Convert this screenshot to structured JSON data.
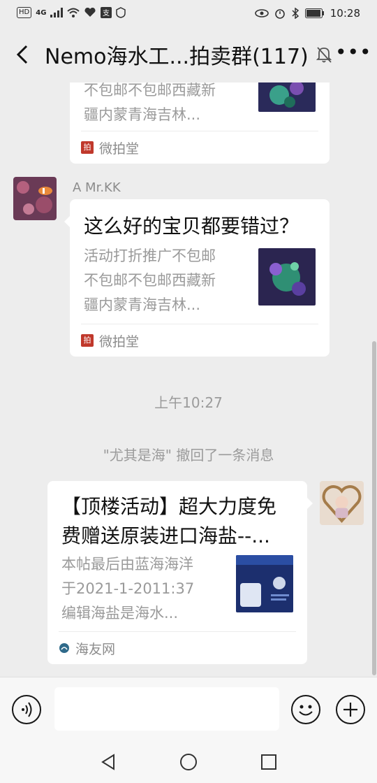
{
  "status_bar": {
    "network_badges": [
      "HD",
      "4G"
    ],
    "time": "10:28"
  },
  "header": {
    "title": "Nemo海水工...拍卖群(117)"
  },
  "messages": [
    {
      "desc_lines": [
        "不包邮不包邮西藏新",
        "疆内蒙青海吉林..."
      ],
      "source": "微拍堂"
    },
    {
      "sender": "A  Mr.KK",
      "title": "这么好的宝贝都要错过？",
      "desc_lines": [
        "活动打折推广不包邮",
        "不包邮不包邮西藏新",
        "疆内蒙青海吉林..."
      ],
      "source": "微拍堂"
    },
    {
      "timestamp": "上午10:27"
    },
    {
      "system": "\"尤其是海\" 撤回了一条消息"
    },
    {
      "title_lines": [
        "【顶楼活动】超大力度免",
        "费赠送原装进口海盐--..."
      ],
      "desc_lines": [
        "本帖最后由蓝海海洋",
        "于2021-1-2011:37",
        "编辑海盐是海水..."
      ],
      "source": "海友网"
    }
  ]
}
